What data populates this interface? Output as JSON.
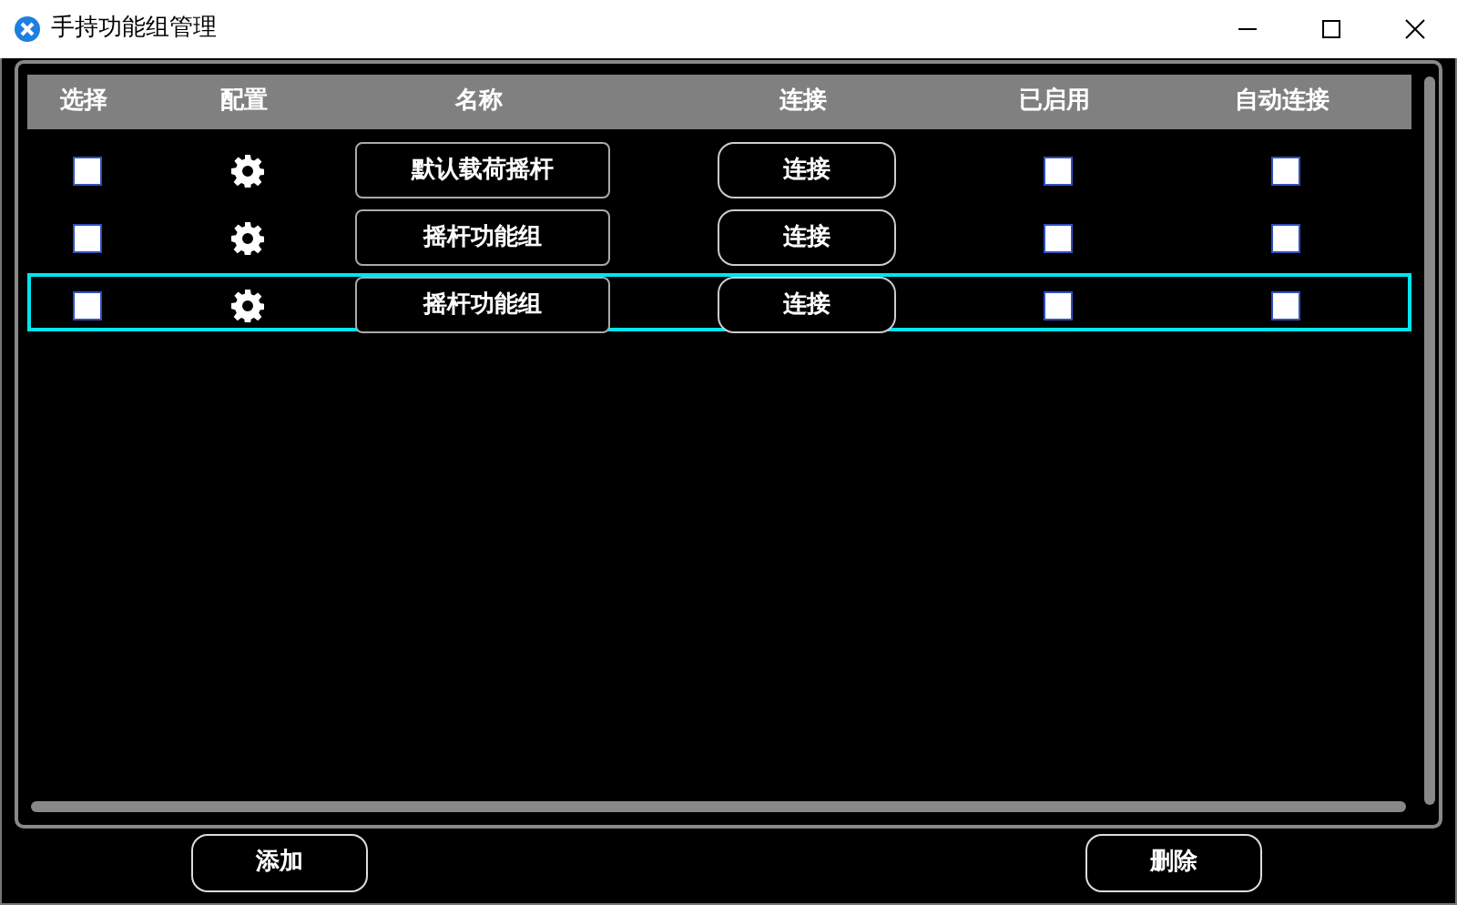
{
  "window": {
    "title": "手持功能组管理"
  },
  "table": {
    "columns": [
      "选择",
      "配置",
      "名称",
      "连接",
      "已启用",
      "自动连接"
    ],
    "rows": [
      {
        "checked": false,
        "name": "默认载荷摇杆",
        "connect": "连接",
        "enabled": false,
        "auto_connect": false,
        "selected": false
      },
      {
        "checked": false,
        "name": "摇杆功能组",
        "connect": "连接",
        "enabled": false,
        "auto_connect": false,
        "selected": false
      },
      {
        "checked": false,
        "name": "摇杆功能组",
        "connect": "连接",
        "enabled": false,
        "auto_connect": false,
        "selected": true
      }
    ]
  },
  "buttons": [
    "添加",
    "删除"
  ]
}
